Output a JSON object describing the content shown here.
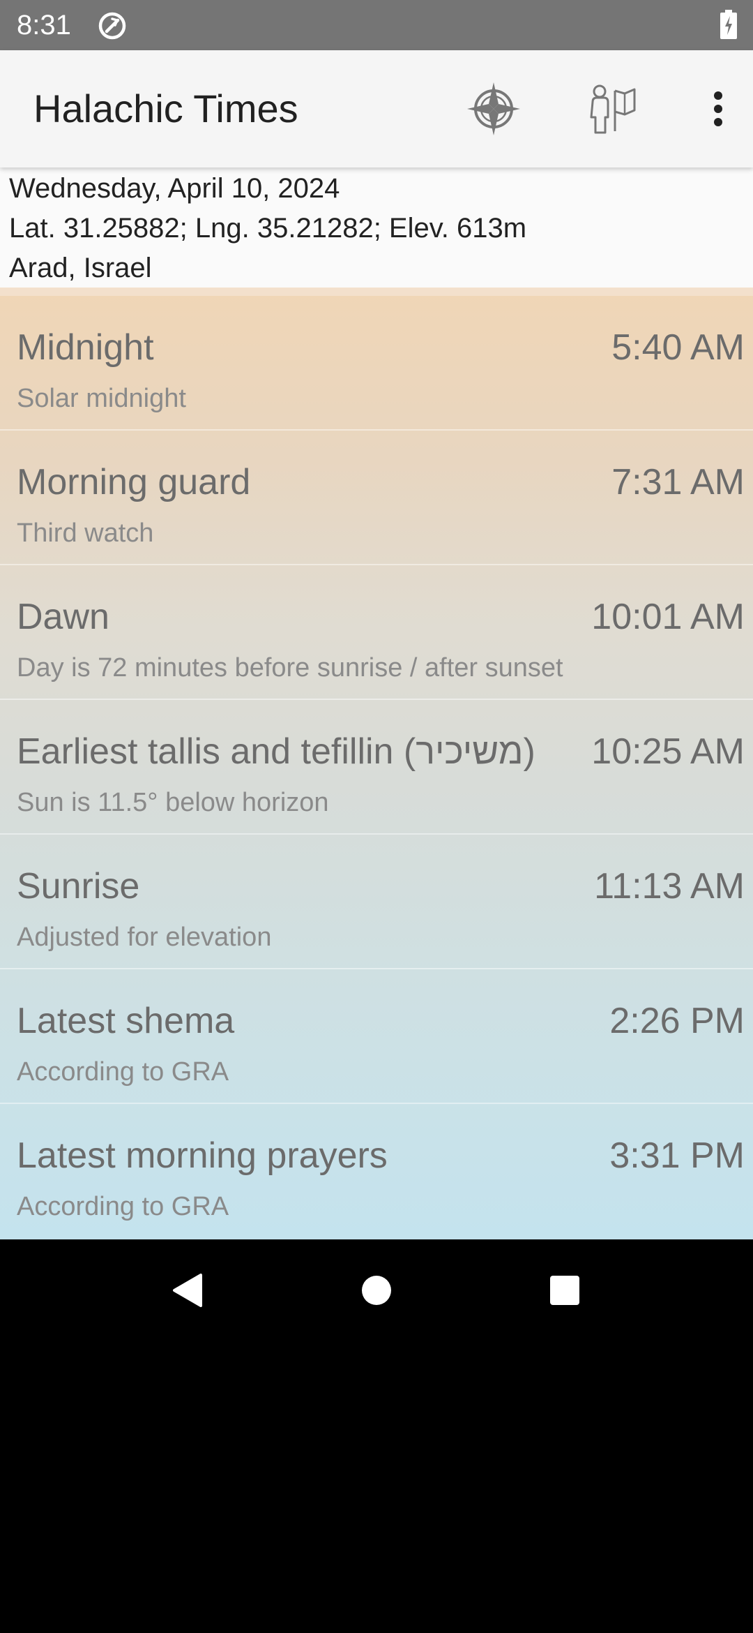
{
  "status_bar": {
    "time": "8:31",
    "icons": [
      "sync-icon",
      "battery-charging-icon"
    ]
  },
  "app_bar": {
    "title": "Halachic Times",
    "actions": [
      "compass-icon",
      "location-map-icon",
      "more-vert-icon"
    ]
  },
  "header": {
    "date": "Wednesday, April 10, 2024",
    "coordinates": "Lat. 31.25882; Lng. 35.21282; Elev. 613m",
    "location": "Arad, Israel"
  },
  "times": [
    {
      "title": "Midnight",
      "time": "5:40 AM",
      "summary": "Solar midnight"
    },
    {
      "title": "Morning guard",
      "time": "7:31 AM",
      "summary": "Third watch"
    },
    {
      "title": "Dawn",
      "time": "10:01 AM",
      "summary": "Day is 72 minutes before sunrise / after sunset"
    },
    {
      "title": "Earliest tallis and tefillin (משיכיר)",
      "time": "10:25 AM",
      "summary": "Sun is 11.5° below horizon"
    },
    {
      "title": "Sunrise",
      "time": "11:13 AM",
      "summary": "Adjusted for elevation"
    },
    {
      "title": "Latest shema",
      "time": "2:26 PM",
      "summary": "According to GRA"
    },
    {
      "title": "Latest morning prayers",
      "time": "3:31 PM",
      "summary": "According to GRA"
    }
  ],
  "colors": {
    "status_bar": "#757575",
    "app_bar": "#f5f5f5",
    "gradient_top": "#f0d6b6",
    "gradient_bottom": "#c4e3ee",
    "text_primary": "#6b6b6b",
    "text_secondary": "#8a8a8a"
  }
}
